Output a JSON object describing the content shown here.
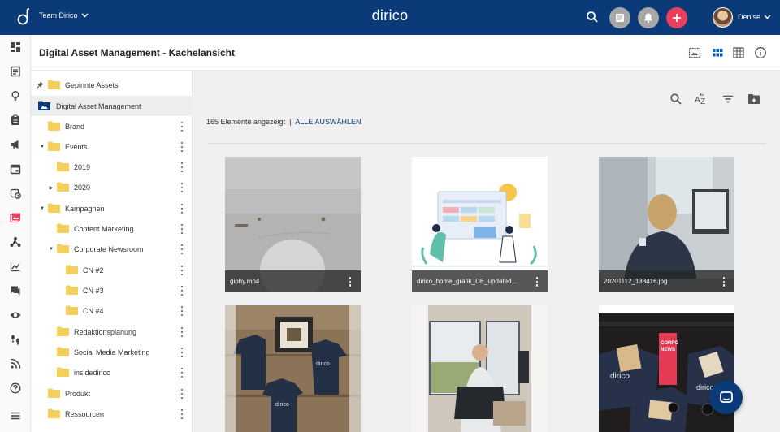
{
  "app": {
    "team_label": "Team Dirico",
    "brand": "dirico",
    "user_name": "Denise"
  },
  "page": {
    "title": "Digital Asset Management - Kachelansicht"
  },
  "nav_rail": [
    "dashboard-icon",
    "planning-icon",
    "ideas-icon",
    "tasks-icon",
    "campaign-icon",
    "calendar-icon",
    "schedule-icon",
    "assets-icon",
    "network-icon",
    "analytics-icon",
    "comments-icon",
    "monitoring-icon",
    "journey-icon",
    "rss-icon",
    "help-icon",
    "menu-icon"
  ],
  "tree": [
    {
      "label": "Gepinnte Assets"
    },
    {
      "label": "Digital Asset Management"
    },
    {
      "label": "Brand"
    },
    {
      "label": "Events"
    },
    {
      "label": "2019"
    },
    {
      "label": "2020"
    },
    {
      "label": "Kampagnen"
    },
    {
      "label": "Content Marketing"
    },
    {
      "label": "Corporate Newsroom"
    },
    {
      "label": "CN #2"
    },
    {
      "label": "CN #3"
    },
    {
      "label": "CN #4"
    },
    {
      "label": "Redaktionsplanung"
    },
    {
      "label": "Social Media Marketing"
    },
    {
      "label": "insidedirico"
    },
    {
      "label": "Produkt"
    },
    {
      "label": "Ressourcen"
    }
  ],
  "content": {
    "count_text": "165 Elemente angezeigt",
    "separator": "|",
    "select_all": "ALLE AUSWÄHLEN",
    "tiles": [
      {
        "name": "giphy.mp4"
      },
      {
        "name": "dirico_home_grafik_DE_updated..."
      },
      {
        "name": "20201112_133416.jpg"
      },
      {
        "name": ""
      },
      {
        "name": ""
      },
      {
        "name": ""
      }
    ]
  },
  "colors": {
    "topbar": "#0b3a78",
    "accent_red": "#e9415b",
    "folder": "#f5cf5b",
    "link": "#0b3a78"
  }
}
